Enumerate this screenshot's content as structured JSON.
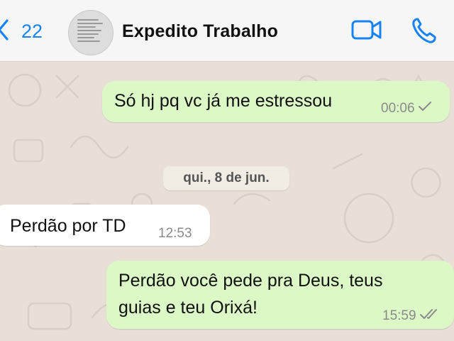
{
  "header": {
    "back_count": "22",
    "contact_name": "Expedito Trabalho",
    "icons": {
      "back": "chevron-left-icon",
      "video": "video-camera-icon",
      "call": "phone-icon"
    }
  },
  "messages": [
    {
      "direction": "outgoing",
      "text": "Só hj pq vc já me estressou",
      "time": "00:06",
      "status": "sent"
    },
    {
      "type": "date_separator",
      "text": "qui., 8 de jun."
    },
    {
      "direction": "incoming",
      "text": "Perdão por TD",
      "time": "12:53"
    },
    {
      "direction": "outgoing",
      "lines": [
        "Perdão você pede pra Deus, teus",
        "guias e teu Orixá!"
      ],
      "time": "15:59",
      "status": "read"
    }
  ],
  "colors": {
    "accent": "#1683f5",
    "outgoing_bubble": "#dcf8c6",
    "incoming_bubble": "#ffffff",
    "chat_background": "#e8e0d7"
  }
}
